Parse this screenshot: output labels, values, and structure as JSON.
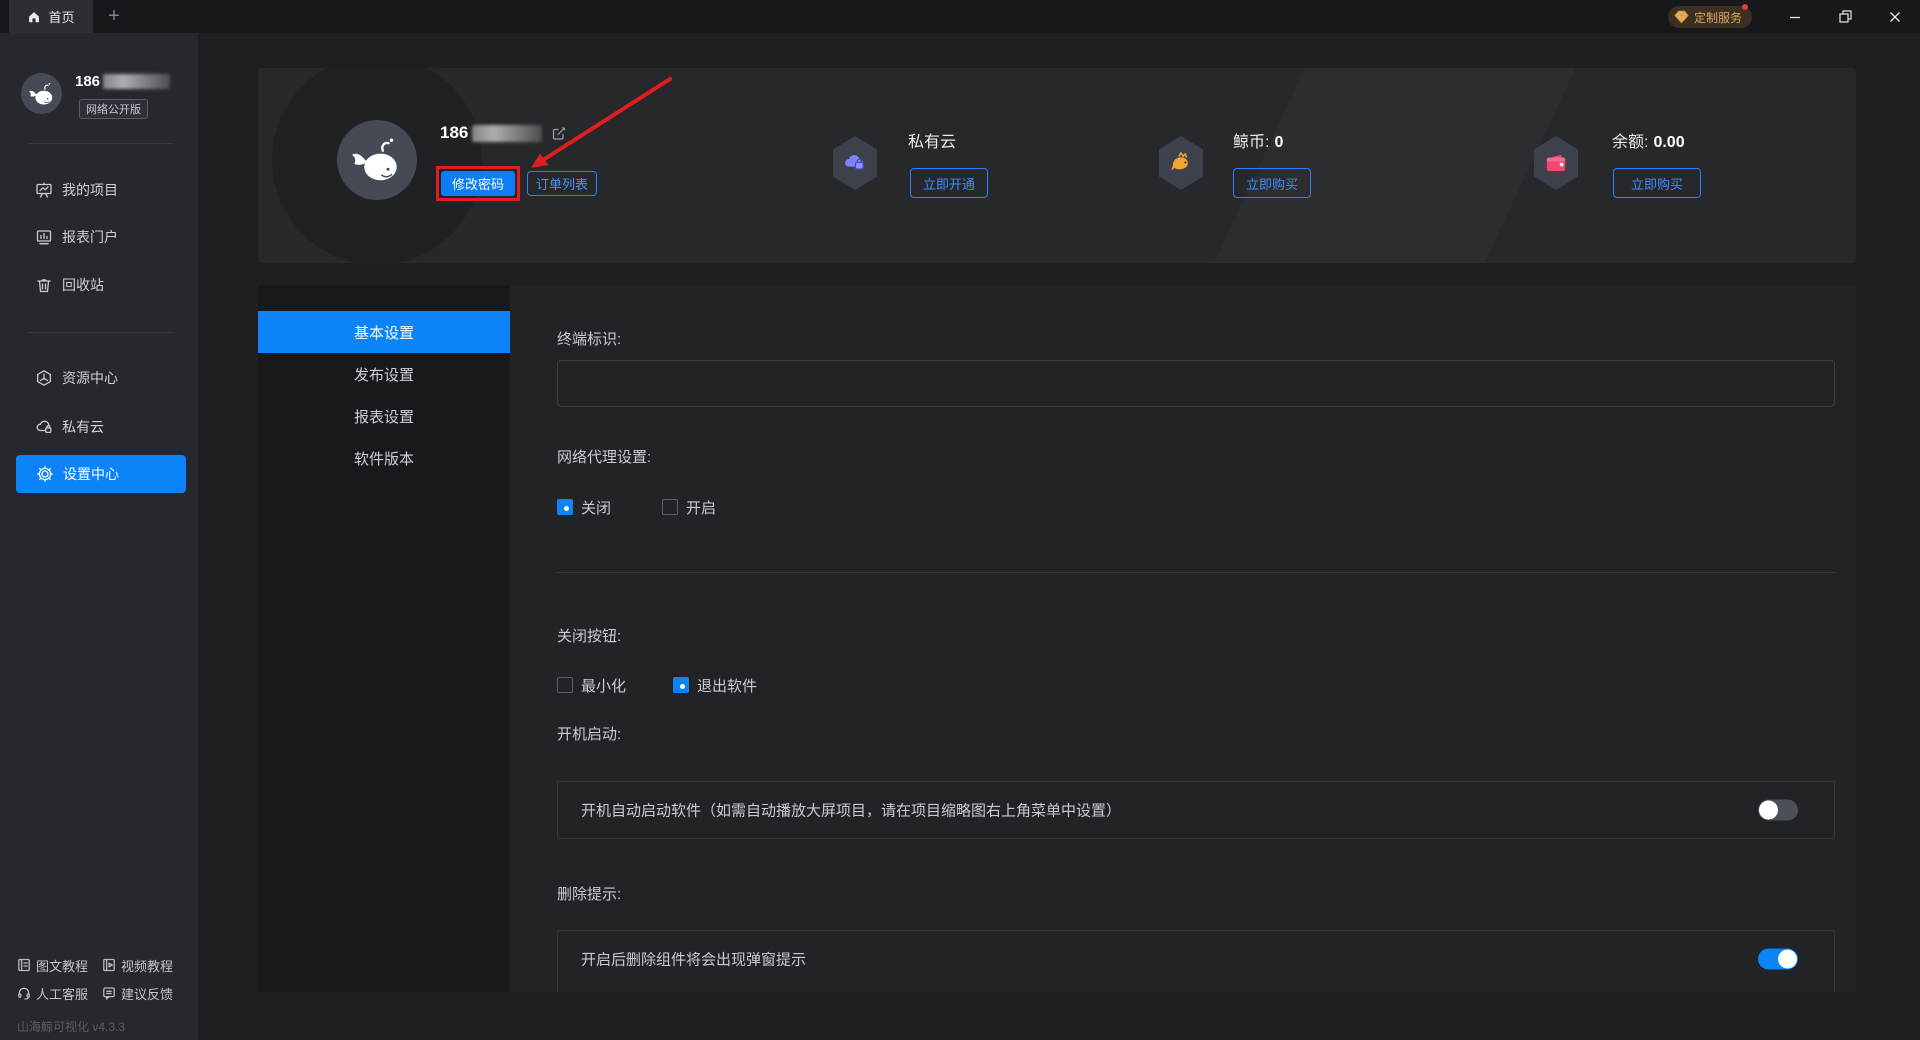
{
  "app": {
    "version_text": "山海鲸可视化 v4.3.3"
  },
  "titlebar": {
    "home_tab": "首页",
    "new_tab": "+",
    "custom_service": "定制服务"
  },
  "sidebar": {
    "user": {
      "name_prefix": "186",
      "name_masked": true,
      "plan_badge": "网络公开版"
    },
    "menu": [
      {
        "label": "我的项目",
        "icon": "project-board-icon",
        "active": false
      },
      {
        "label": "报表门户",
        "icon": "report-portal-icon",
        "active": false
      },
      {
        "label": "回收站",
        "icon": "trash-icon",
        "active": false
      },
      {
        "label": "资源中心",
        "icon": "resource-hexagon-icon",
        "active": false
      },
      {
        "label": "私有云",
        "icon": "cloud-lock-icon",
        "active": false
      },
      {
        "label": "设置中心",
        "icon": "gear-icon",
        "active": true
      }
    ],
    "footer_links": [
      {
        "label": "图文教程",
        "icon": "doc-tutorial-icon"
      },
      {
        "label": "视频教程",
        "icon": "video-tutorial-icon"
      },
      {
        "label": "人工客服",
        "icon": "headset-icon"
      },
      {
        "label": "建议反馈",
        "icon": "feedback-icon"
      }
    ]
  },
  "banner": {
    "name_prefix": "186",
    "name_masked": true,
    "change_password": "修改密码",
    "order_list": "订单列表",
    "annotation": {
      "type": "red-box-and-arrow",
      "target": "change_password",
      "color": "#e01e1e"
    },
    "cards": [
      {
        "title": "私有云",
        "value": "",
        "action": "立即开通",
        "icon": "private-cloud-purple-icon"
      },
      {
        "title": "鲸币:",
        "value": "0",
        "action": "立即购买",
        "icon": "whale-coin-orange-icon"
      },
      {
        "title": "余额:",
        "value": "0.00",
        "action": "立即购买",
        "icon": "wallet-pink-icon"
      }
    ]
  },
  "settings": {
    "tabs": [
      {
        "label": "基本设置",
        "active": true
      },
      {
        "label": "发布设置",
        "active": false
      },
      {
        "label": "报表设置",
        "active": false
      },
      {
        "label": "软件版本",
        "active": false
      }
    ],
    "terminal": {
      "label": "终端标识:",
      "value": ""
    },
    "proxy": {
      "label": "网络代理设置:",
      "options": [
        {
          "label": "关闭",
          "checked": true
        },
        {
          "label": "开启",
          "checked": false
        }
      ]
    },
    "close_button": {
      "label": "关闭按钮:",
      "options": [
        {
          "label": "最小化",
          "checked": false
        },
        {
          "label": "退出软件",
          "checked": true
        }
      ]
    },
    "autostart": {
      "label": "开机启动:",
      "desc": "开机自动启动软件（如需自动播放大屏项目，请在项目缩略图右上角菜单中设置）",
      "enabled": false
    },
    "delete_tip": {
      "label": "删除提示:",
      "desc": "开启后删除组件将会出现弹窗提示",
      "enabled": true
    }
  },
  "colors": {
    "accent": "#0c83f8",
    "outline_button": "#2f80f7",
    "annotation_red": "#e01e1e",
    "badge_gold": "#d9a45e",
    "hex_purple": "#7e83f5",
    "hex_orange": "#f5a332",
    "hex_pink": "#f2456f"
  }
}
